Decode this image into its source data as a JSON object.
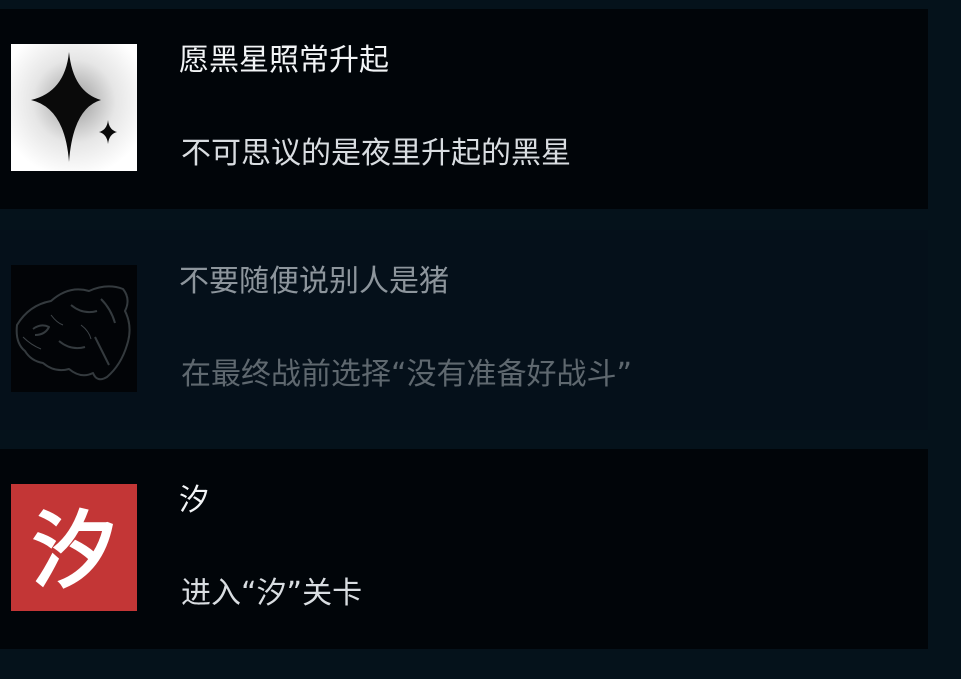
{
  "achievements": [
    {
      "title": "愿黑星照常升起",
      "description": "不可思议的是夜里升起的黑星",
      "icon": "black-star-icon",
      "unlocked": true
    },
    {
      "title": "不要随便说别人是猪",
      "description": "在最终战前选择“没有准备好战斗”",
      "icon": "pig-icon",
      "unlocked": false
    },
    {
      "title": "汐",
      "description": "进入“汐”关卡",
      "icon": "xi-calligraphy-icon",
      "icon_glyph": "汐",
      "unlocked": true
    }
  ],
  "colors": {
    "page_background": "#05121b",
    "unlocked_card": "#010509",
    "locked_card": "#05101a",
    "xi_icon_red": "#c93a3a"
  }
}
